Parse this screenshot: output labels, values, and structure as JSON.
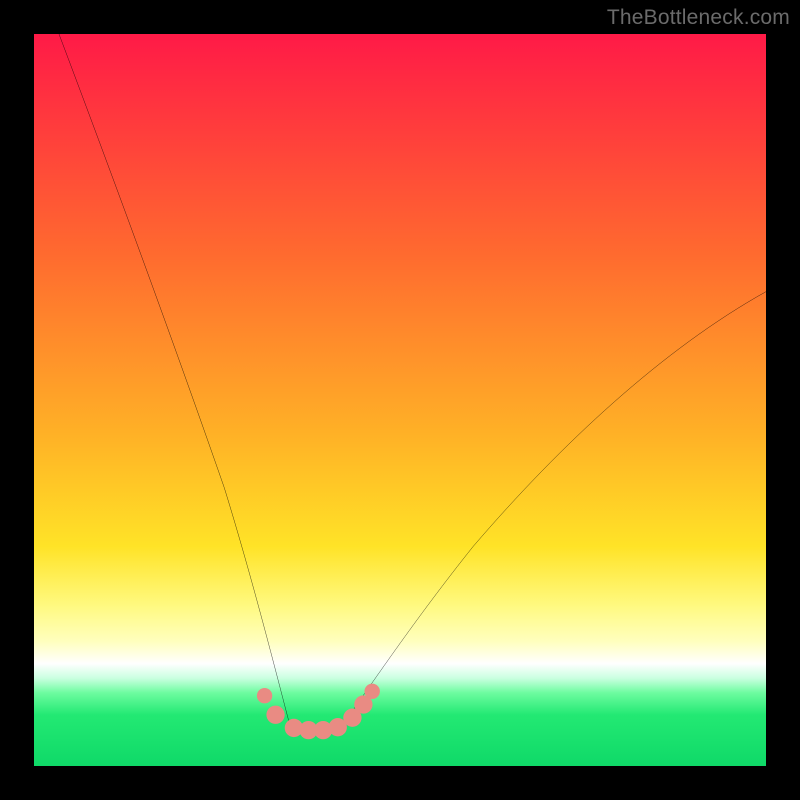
{
  "watermark": "TheBottleneck.com",
  "chart_data": {
    "type": "line",
    "title": "",
    "xlabel": "",
    "ylabel": "",
    "xlim": [
      0,
      100
    ],
    "ylim": [
      0,
      100
    ],
    "series": [
      {
        "name": "curve-left",
        "x": [
          0,
          5,
          10,
          15,
          20,
          23,
          26,
          28,
          30,
          32,
          33.5,
          35
        ],
        "values": [
          109,
          95,
          80,
          63,
          46,
          36,
          26,
          19,
          13,
          8.5,
          6.7,
          5.4
        ]
      },
      {
        "name": "curve-right",
        "x": [
          42,
          45,
          50,
          55,
          60,
          65,
          70,
          75,
          80,
          85,
          90,
          95,
          100
        ],
        "values": [
          5.4,
          8.5,
          14,
          20,
          26,
          32,
          37.7,
          43,
          48,
          52.8,
          57,
          61,
          64.8
        ]
      },
      {
        "name": "valley-floor",
        "x": [
          35,
          36,
          38,
          40,
          42
        ],
        "values": [
          5.4,
          5.0,
          4.8,
          5.0,
          5.4
        ]
      }
    ],
    "markers": {
      "name": "highlighted-points",
      "color": "#e98b83",
      "points": [
        {
          "x": 31.5,
          "y": 9.6
        },
        {
          "x": 33.0,
          "y": 7.0
        },
        {
          "x": 35.5,
          "y": 5.2
        },
        {
          "x": 37.5,
          "y": 4.9
        },
        {
          "x": 39.5,
          "y": 4.9
        },
        {
          "x": 41.5,
          "y": 5.3
        },
        {
          "x": 43.5,
          "y": 6.6
        },
        {
          "x": 45.0,
          "y": 8.4
        },
        {
          "x": 46.2,
          "y": 10.2
        }
      ]
    },
    "background_gradient": {
      "top": "#ff1a47",
      "mid_upper": "#ffb226",
      "mid": "#ffe327",
      "mid_lower": "#ffffff",
      "bottom": "#0fd968",
      "description": "vertical red-to-green gradient"
    }
  }
}
